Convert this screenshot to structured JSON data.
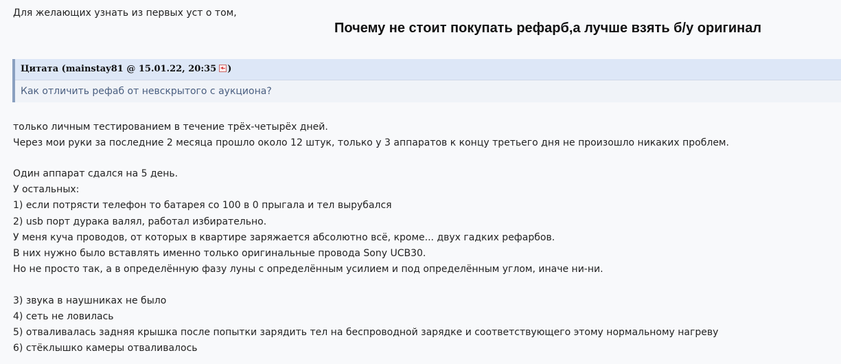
{
  "post": {
    "intro": "Для желающих узнать из первых уст о том,",
    "headline": "Почему не стоит покупать рефарб,а лучше взять б/у оригинал",
    "quote": {
      "title_prefix": "Цитата (mainstay81 @ 15.01.22, 20:35",
      "title_suffix": ")",
      "jump_icon": "arrow-left-icon",
      "text": "Как отличить рефаб от невскрытого с аукциона?"
    },
    "lines": [
      "только личным тестированием в течение трёх-четырёх дней.",
      "Через мои руки за последние 2 месяца прошло около 12 штук, только у 3 аппаратов к концу третьего дня не произошло никаких проблем.",
      "Один аппарат сдался на 5 день.",
      "У остальных:",
      "1) если потрясти телефон то батарея со 100 в 0 прыгала и тел вырубался",
      "2) usb порт дурака валял, работал избирательно.",
      "У меня куча проводов, от которых в квартире заряжается абсолютно всё, кроме... двух гадких рефарбов.",
      "В них нужно было вставлять именно только оригинальные провода Sony UCB30.",
      "Но не просто так, а в определённую фазу луны с определённым усилием и под определённым углом, иначе ни-ни.",
      "3) звука в наушниках не было",
      "4) сеть не ловилась",
      "5) отваливалась задняя крышка после попытки зарядить тел на беспроводной зарядке и соответствующего этому нормальному нагреву",
      "6) стёклышко камеры отваливалось"
    ]
  },
  "colors": {
    "background": "#f8f9fb",
    "quote_header": "#dde7f7",
    "quote_border": "#8aa0c0",
    "quote_text": "#4a5f80",
    "body_text": "#222222"
  }
}
